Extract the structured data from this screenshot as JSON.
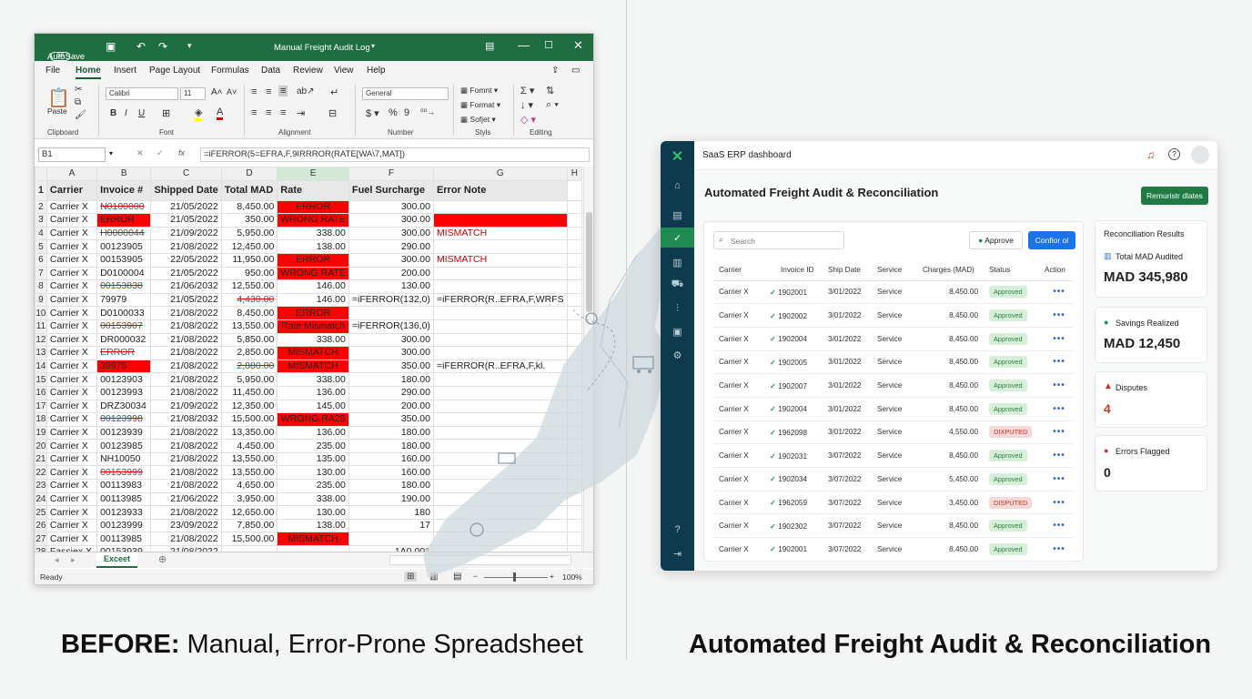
{
  "excel": {
    "titlebar": {
      "autosave": "AutoSave",
      "autosave_state": "Off",
      "title": "Manual Freight Audit Log"
    },
    "tabs": [
      "File",
      "Home",
      "Insert",
      "Page Layout",
      "Formulas",
      "Data",
      "Review",
      "View",
      "Help"
    ],
    "ribbon": {
      "paste": "Paste",
      "font_name": "Calibri",
      "font_size": "11",
      "number_format": "General",
      "cond_format": "Fomnt",
      "format_table": "Format",
      "cell_styles": "Sofjet",
      "groups": {
        "clipboard": "Clipboard",
        "font": "Font",
        "alignment": "Alignment",
        "number": "Number",
        "styles": "Styls",
        "editing": "Editing"
      }
    },
    "name_box": "B1",
    "formula": "=iFERROR(5=EFRA,F,9IRRROR(RATE[WA\\7,MAT])",
    "columns": [
      "A",
      "B",
      "C",
      "D",
      "E",
      "F",
      "G",
      "H"
    ],
    "headers": [
      "Carrier",
      "Invoice #",
      "Shipped Date",
      "Total MAD",
      "Rate",
      "Fuel Surcharge",
      "Error Note"
    ],
    "rows": [
      {
        "n": "2",
        "a": "Carrier X",
        "b": "N0100000",
        "c": "21/05/2022",
        "d": "8,450.00",
        "e": "ERROR",
        "f": "300.00",
        "g": ""
      },
      {
        "n": "3",
        "a": "Carrier X",
        "b": "ERROR",
        "c": "21/05/2022",
        "d": "350.00",
        "e": "WRONG RATE",
        "f": "300.00",
        "g": ""
      },
      {
        "n": "4",
        "a": "Carrier X",
        "b": "H0000044",
        "c": "21/09/2022",
        "d": "5,950.00",
        "e": "338.00",
        "f": "300.00",
        "g": "MISMATCH"
      },
      {
        "n": "5",
        "a": "Carrier X",
        "b": "00123905",
        "c": "21/08/2022",
        "d": "12,450.00",
        "e": "138.00",
        "f": "290.00",
        "g": ""
      },
      {
        "n": "6",
        "a": "Carrier X",
        "b": "00153905",
        "c": "22/05/2022",
        "d": "11,950.00",
        "e": "ERROR",
        "f": "300.00",
        "g": "MISMATCH"
      },
      {
        "n": "7",
        "a": "Carrier X",
        "b": "D0100004",
        "c": "21/05/2022",
        "d": "950.00",
        "e": "WRONG RATE",
        "f": "200.00",
        "g": ""
      },
      {
        "n": "8",
        "a": "Carrier X",
        "b": "00153838",
        "c": "21/06/2032",
        "d": "12,550.00",
        "e": "146.00",
        "f": "130.00",
        "g": ""
      },
      {
        "n": "9",
        "a": "Carrier X",
        "b": "79979",
        "c": "21/05/2022",
        "d": "4,430.00",
        "e": "146.00",
        "f": "=iFERROR(132,0)",
        "g": "=iFERROR(R..EFRA,F,WRFS"
      },
      {
        "n": "10",
        "a": "Carrier X",
        "b": "D0100033",
        "c": "21/08/2022",
        "d": "8,450.00",
        "e": "ERROR",
        "f": "",
        "g": ""
      },
      {
        "n": "11",
        "a": "Carrier X",
        "b": "00153907",
        "c": "21/08/2022",
        "d": "13,550.00",
        "e": "Rate Mismatch",
        "f": "=iFERROR(136,0)",
        "g": ""
      },
      {
        "n": "12",
        "a": "Carrier X",
        "b": "DR000032",
        "c": "21/08/2022",
        "d": "5,850.00",
        "e": "338.00",
        "f": "300.00",
        "g": ""
      },
      {
        "n": "13",
        "a": "Carrier X",
        "b": "ERROR",
        "c": "21/08/2022",
        "d": "2,850.00",
        "e": "MISMATCH",
        "f": "300.00",
        "g": ""
      },
      {
        "n": "14",
        "a": "Carrier X",
        "b": "39975",
        "c": "21/08/2022",
        "d": "2,880.00",
        "e": "MISMATCH",
        "f": "350.00",
        "g": "=iFERROR(R..EFRA,F,kl."
      },
      {
        "n": "15",
        "a": "Carrier X",
        "b": "00123903",
        "c": "21/08/2022",
        "d": "5,950.00",
        "e": "338.00",
        "f": "180.00",
        "g": ""
      },
      {
        "n": "16",
        "a": "Carrier X",
        "b": "00123993",
        "c": "21/08/2022",
        "d": "11,450.00",
        "e": "136.00",
        "f": "290.00",
        "g": ""
      },
      {
        "n": "17",
        "a": "Carrier X",
        "b": "DRZ30034",
        "c": "21/09/2022",
        "d": "12,350.00",
        "e": "145.00",
        "f": "200.00",
        "g": ""
      },
      {
        "n": "18",
        "a": "Carrier X",
        "b": "00123998",
        "c": "21/08/2032",
        "d": "15,500.00",
        "e": "WRONG.RA28",
        "f": "350.00",
        "g": ""
      },
      {
        "n": "19",
        "a": "Carrier X",
        "b": "00123939",
        "c": "21/08/2022",
        "d": "13,350.00",
        "e": "136.00",
        "f": "180.00",
        "g": ""
      },
      {
        "n": "20",
        "a": "Carrier X",
        "b": "00123985",
        "c": "21/08/2022",
        "d": "4,450.00",
        "e": "235.00",
        "f": "180.00",
        "g": ""
      },
      {
        "n": "21",
        "a": "Carrier X",
        "b": "NH10050",
        "c": "21/08/2022",
        "d": "13,550.00",
        "e": "135.00",
        "f": "160.00",
        "g": ""
      },
      {
        "n": "22",
        "a": "Carrier X",
        "b": "00153999",
        "c": "21/08/2022",
        "d": "13,550.00",
        "e": "130.00",
        "f": "160.00",
        "g": ""
      },
      {
        "n": "23",
        "a": "Carrier X",
        "b": "00113983",
        "c": "21/08/2022",
        "d": "4,650.00",
        "e": "235.00",
        "f": "180.00",
        "g": ""
      },
      {
        "n": "24",
        "a": "Carrier X",
        "b": "00113985",
        "c": "21/06/2022",
        "d": "3,950.00",
        "e": "338.00",
        "f": "190.00",
        "g": ""
      },
      {
        "n": "25",
        "a": "Carrier X",
        "b": "00123933",
        "c": "21/08/2022",
        "d": "12,650.00",
        "e": "130.00",
        "f": "180",
        "g": ""
      },
      {
        "n": "26",
        "a": "Carrier X",
        "b": "00123999",
        "c": "23/09/2022",
        "d": "7,850.00",
        "e": "138.00",
        "f": "17",
        "g": ""
      },
      {
        "n": "27",
        "a": "Carrier X",
        "b": "00113985",
        "c": "21/08/2022",
        "d": "15,500.00",
        "e": "MISMATCH",
        "f": "",
        "g": ""
      },
      {
        "n": "28",
        "a": "Fassiex X",
        "b": "00153939",
        "c": "21/08/2022",
        "d": "",
        "e": "",
        "f": "1A0.001",
        "g": ""
      }
    ],
    "sheet_tab": "Exceet",
    "status": "Ready",
    "zoom": "100%"
  },
  "erp": {
    "top_title": "SaaS ERP dashboard",
    "page_title": "Automated Freight Audit & Reconciliation",
    "primary_button": "Remuristr dlates",
    "search_placeholder": "Search",
    "approve_button": "Approve",
    "confirm_button": "Confior ol",
    "columns": [
      "Carrier",
      "Invoice ID",
      "Ship Date",
      "Service",
      "Charges (MAD)",
      "Status",
      "Action"
    ],
    "rows": [
      {
        "carrier": "Carrier X",
        "id": "1902001",
        "date": "3/01/2022",
        "service": "Service",
        "charges": "8,450.00",
        "status": "Approved"
      },
      {
        "carrier": "Carrier X",
        "id": "1902002",
        "date": "3/01/2022",
        "service": "Service",
        "charges": "8,450.00",
        "status": "Approved"
      },
      {
        "carrier": "Carrier X",
        "id": "1902004",
        "date": "3/01/2022",
        "service": "Service",
        "charges": "8,450.00",
        "status": "Approved"
      },
      {
        "carrier": "Carrier X",
        "id": "1902005",
        "date": "3/01/2022",
        "service": "Service",
        "charges": "8,450.00",
        "status": "Approved"
      },
      {
        "carrier": "Carrier X",
        "id": "1902007",
        "date": "3/01/2022",
        "service": "Service",
        "charges": "8,450.00",
        "status": "Approved"
      },
      {
        "carrier": "Carrier X",
        "id": "1902004",
        "date": "3/01/2022",
        "service": "Service",
        "charges": "8,450.00",
        "status": "Approved"
      },
      {
        "carrier": "Carrier X",
        "id": "1962098",
        "date": "3/01/2022",
        "service": "Service",
        "charges": "4,550.00",
        "status": "DIXPUTED"
      },
      {
        "carrier": "Carrier X",
        "id": "1902031",
        "date": "3/07/2022",
        "service": "Service",
        "charges": "8,450.00",
        "status": "Approved"
      },
      {
        "carrier": "Carrier X",
        "id": "1902034",
        "date": "3/07/2022",
        "service": "Service",
        "charges": "5,450.00",
        "status": "Approved"
      },
      {
        "carrier": "Carrier X",
        "id": "1962059",
        "date": "3/07/2022",
        "service": "Service",
        "charges": "3,450.00",
        "status": "DISPUTED"
      },
      {
        "carrier": "Carrier X",
        "id": "1902302",
        "date": "3/07/2022",
        "service": "Service",
        "charges": "8,450.00",
        "status": "Approved"
      },
      {
        "carrier": "Carrier X",
        "id": "1902001",
        "date": "3/07/2022",
        "service": "Service",
        "charges": "8,450.00",
        "status": "Approved"
      }
    ],
    "results": {
      "title": "Reconciliation Results",
      "total_label": "Total MAD Audited",
      "total_value": "MAD 345,980",
      "savings_label": "Savings Realized",
      "savings_value": "MAD 12,450",
      "disputes_label": "Disputes",
      "disputes_value": "4",
      "errors_label": "Errors Flagged",
      "errors_value": "0"
    }
  },
  "captions": {
    "before_bold": "BEFORE:",
    "before_rest": " Manual, Error-Prone Spreadsheet",
    "after": "Automated Freight Audit & Reconciliation"
  },
  "colors": {
    "excel_green": "#1e6e42",
    "error_red": "#ff0000",
    "erp_sidebar": "#0d3a4c",
    "erp_green": "#1f8a52",
    "confirm_blue": "#1a73e8"
  }
}
